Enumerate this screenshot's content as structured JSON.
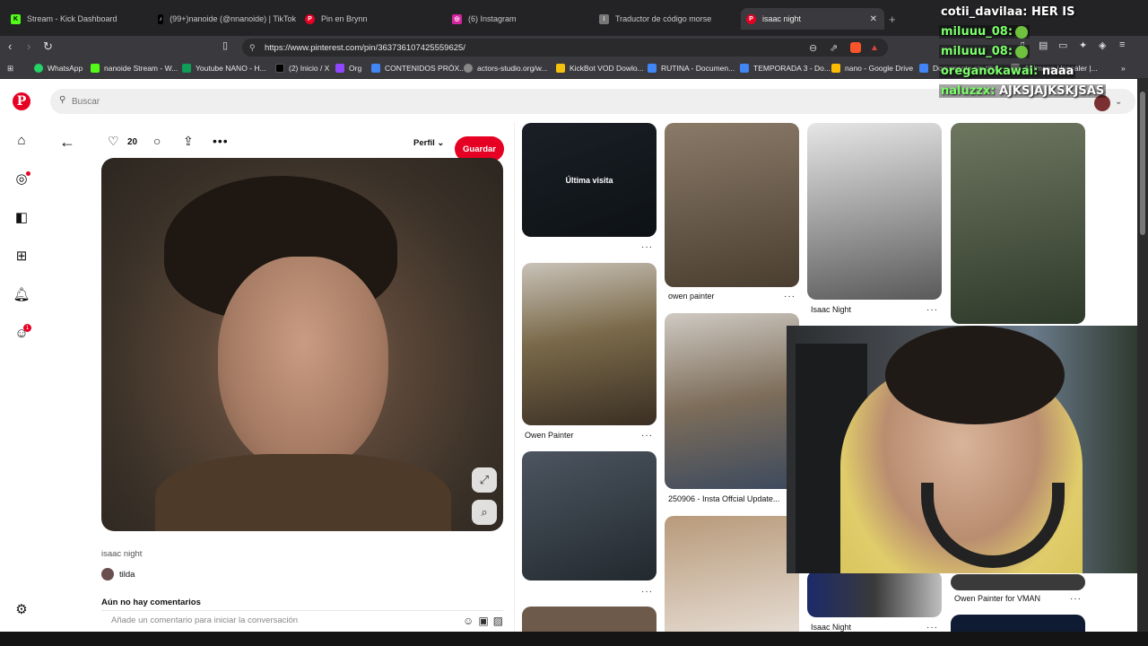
{
  "browser": {
    "tabs": [
      {
        "title": "Stream - Kick Dashboard",
        "icon": "kick-icon",
        "color": "#53fc18"
      },
      {
        "title": "(99+)nanoide (@nnanoide) | TikTok",
        "icon": "tiktok-icon",
        "color": "#000000"
      },
      {
        "title": "Pin en Brynn",
        "icon": "pinterest-icon",
        "color": "#e60023"
      },
      {
        "title": "(6) Instagram",
        "icon": "instagram-icon",
        "color": "#d6249f"
      },
      {
        "title": "Traductor de código morse",
        "icon": "morse-icon",
        "color": "#888888"
      },
      {
        "title": "isaac night",
        "icon": "pinterest-icon",
        "color": "#e60023",
        "active": true
      }
    ],
    "url": "https://www.pinterest.com/pin/363736107425559625/",
    "bookmarks": [
      {
        "label": "WhatsApp",
        "color": "#25d366"
      },
      {
        "label": "nanoide Stream - W...",
        "color": "#53fc18"
      },
      {
        "label": "Youtube NANO - H...",
        "color": "#0f9d58"
      },
      {
        "label": "(2) Inicio / X",
        "color": "#000000"
      },
      {
        "label": "Org",
        "color": "#9146ff"
      },
      {
        "label": "CONTENIDOS PRÓX...",
        "color": "#4285f4"
      },
      {
        "label": "actors-studio.org/w...",
        "color": "#888888"
      },
      {
        "label": "KickBot VOD Dowlo...",
        "color": "#f4c20d"
      },
      {
        "label": "RUTINA - Documen...",
        "color": "#4285f4"
      },
      {
        "label": "TEMPORADA 3 - Do...",
        "color": "#4285f4"
      },
      {
        "label": "nano - Google Drive",
        "color": "#fbbc05"
      },
      {
        "label": "Documento sin títu...",
        "color": "#4285f4"
      },
      {
        "label": "AI Image Upscaler |...",
        "color": "#888888"
      }
    ]
  },
  "pinterest": {
    "search_placeholder": "Buscar",
    "likes": "20",
    "profile_label": "Perfil",
    "save_label": "Guardar",
    "pin_title": "isaac night",
    "author": "tilda",
    "no_comments": "Aún no hay comentarios",
    "comment_placeholder": "Añade un comentario para iniciar la conversación",
    "notification_count": "1",
    "grid": [
      {
        "overlay": "Última visita",
        "caption": ""
      },
      {
        "caption": "owen painter"
      },
      {
        "caption": "Isaac Night"
      },
      {
        "caption": ""
      },
      {
        "caption": "Owen Painter"
      },
      {
        "caption": "250906 - Insta Offcial Update..."
      },
      {
        "caption": ""
      },
      {
        "caption": ""
      },
      {
        "caption": "Isaac Night"
      },
      {
        "caption": "Owen Painter for VMAN"
      }
    ]
  },
  "chat": [
    {
      "user": "cotii_davilaa:",
      "message": "HER IS"
    },
    {
      "user": "miluuu_08:",
      "message": ""
    },
    {
      "user": "miluuu_08:",
      "message": ""
    },
    {
      "user": "oreganokawai:",
      "message": "naaa"
    },
    {
      "user": "naluzzx:",
      "message": "AJKSJAJKSKJSAS"
    }
  ]
}
